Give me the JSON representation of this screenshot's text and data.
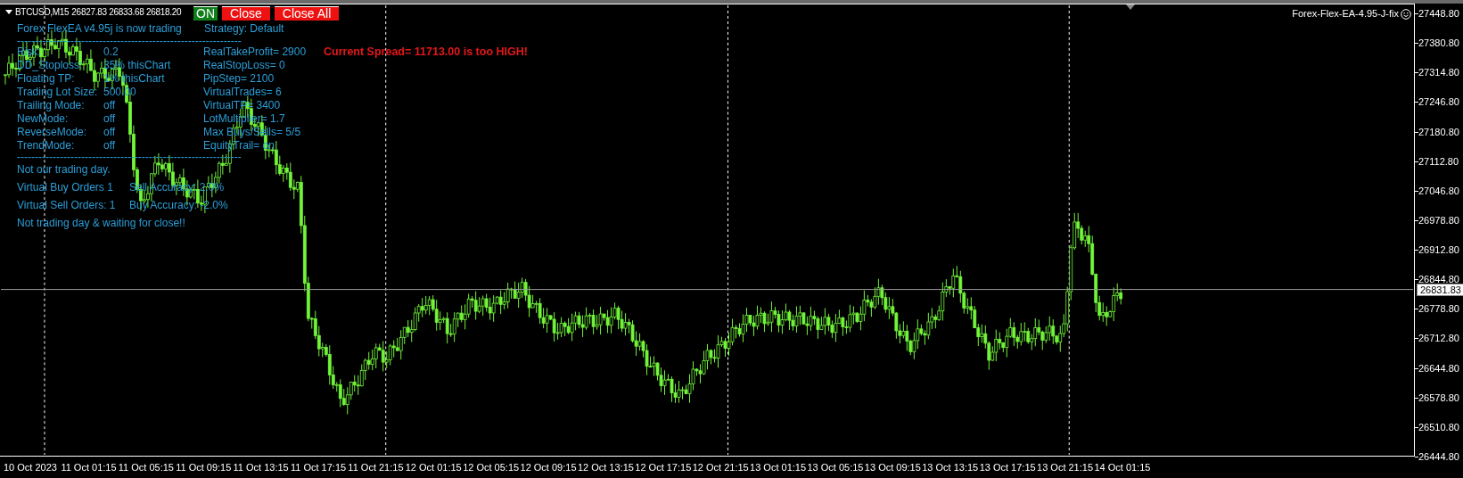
{
  "chart_header": {
    "symbol": "BTCUSD,M15",
    "prices": "26827.83 26833.68 26818.20"
  },
  "buttons": [
    {
      "label": "ON",
      "kind": "toggle",
      "on": true
    },
    {
      "label": "Close",
      "kind": "action"
    },
    {
      "label": "Close All",
      "kind": "action"
    }
  ],
  "expert_label": "Forex-Flex-EA-4.95-J-fix",
  "info_panel": {
    "title": "Forex FlexEA v4.95j is now trading",
    "strategy": "Strategy: Default",
    "separator_top": "---------------------------------------------------------------",
    "settings": [
      {
        "label": "Risk:",
        "value": "0.2",
        "parameter": "RealTakeProfit= 2900"
      },
      {
        "label": "DD_Stoploss:",
        "value": "35%  thisChart",
        "parameter": "RealStopLoss= 0"
      },
      {
        "label": "Floating TP:",
        "value": "1% thisChart",
        "parameter": "PipStep= 2100"
      },
      {
        "label": "Trading Lot Size:",
        "value": "500.00",
        "parameter": "VirtualTrades= 6"
      },
      {
        "label": "Trailing Mode:",
        "value": "off",
        "parameter": "VirtualTP= 3400"
      },
      {
        "label": "NewMode:",
        "value": "off",
        "parameter": "LotMultiplier= 1.7"
      },
      {
        "label": "ReverseMode:",
        "value": "off",
        "parameter": "Max Buys/Sells= 5/5"
      },
      {
        "label": "TrendMode:",
        "value": "off",
        "parameter": "EquityTrail= on"
      }
    ],
    "separator_bottom": "---------------------------------------------------------------",
    "status": "Not our trading day.",
    "orders": [
      {
        "count": "Virtual Buy Orders 1",
        "accuracy": "Sell Accuracy: 2.0%"
      },
      {
        "count": "Virtual Sell Orders: 1",
        "accuracy": "Buy Accuracy: -2.0%"
      }
    ],
    "footer": "Not trading day & waiting for close!!"
  },
  "warning": "Current Spread= 11713.00 is too HIGH!",
  "price_axis": {
    "labels": [
      "27448.80",
      "27380.80",
      "27314.80",
      "27246.80",
      "27180.80",
      "27112.80",
      "27046.80",
      "26978.80",
      "26912.80",
      "26844.80",
      "26778.80",
      "26712.80",
      "26644.80",
      "26578.80",
      "26510.80",
      "26444.80"
    ],
    "current_price": "26831.83"
  },
  "time_axis": {
    "labels": [
      "10 Oct 2023",
      "11 Oct 01:15",
      "11 Oct 05:15",
      "11 Oct 09:15",
      "11 Oct 13:15",
      "11 Oct 17:15",
      "11 Oct 21:15",
      "12 Oct 01:15",
      "12 Oct 05:15",
      "12 Oct 09:15",
      "12 Oct 13:15",
      "12 Oct 17:15",
      "12 Oct 21:15",
      "13 Oct 01:15",
      "13 Oct 05:15",
      "13 Oct 09:15",
      "13 Oct 13:15",
      "13 Oct 17:15",
      "13 Oct 21:15",
      "14 Oct 01:15"
    ]
  }
}
